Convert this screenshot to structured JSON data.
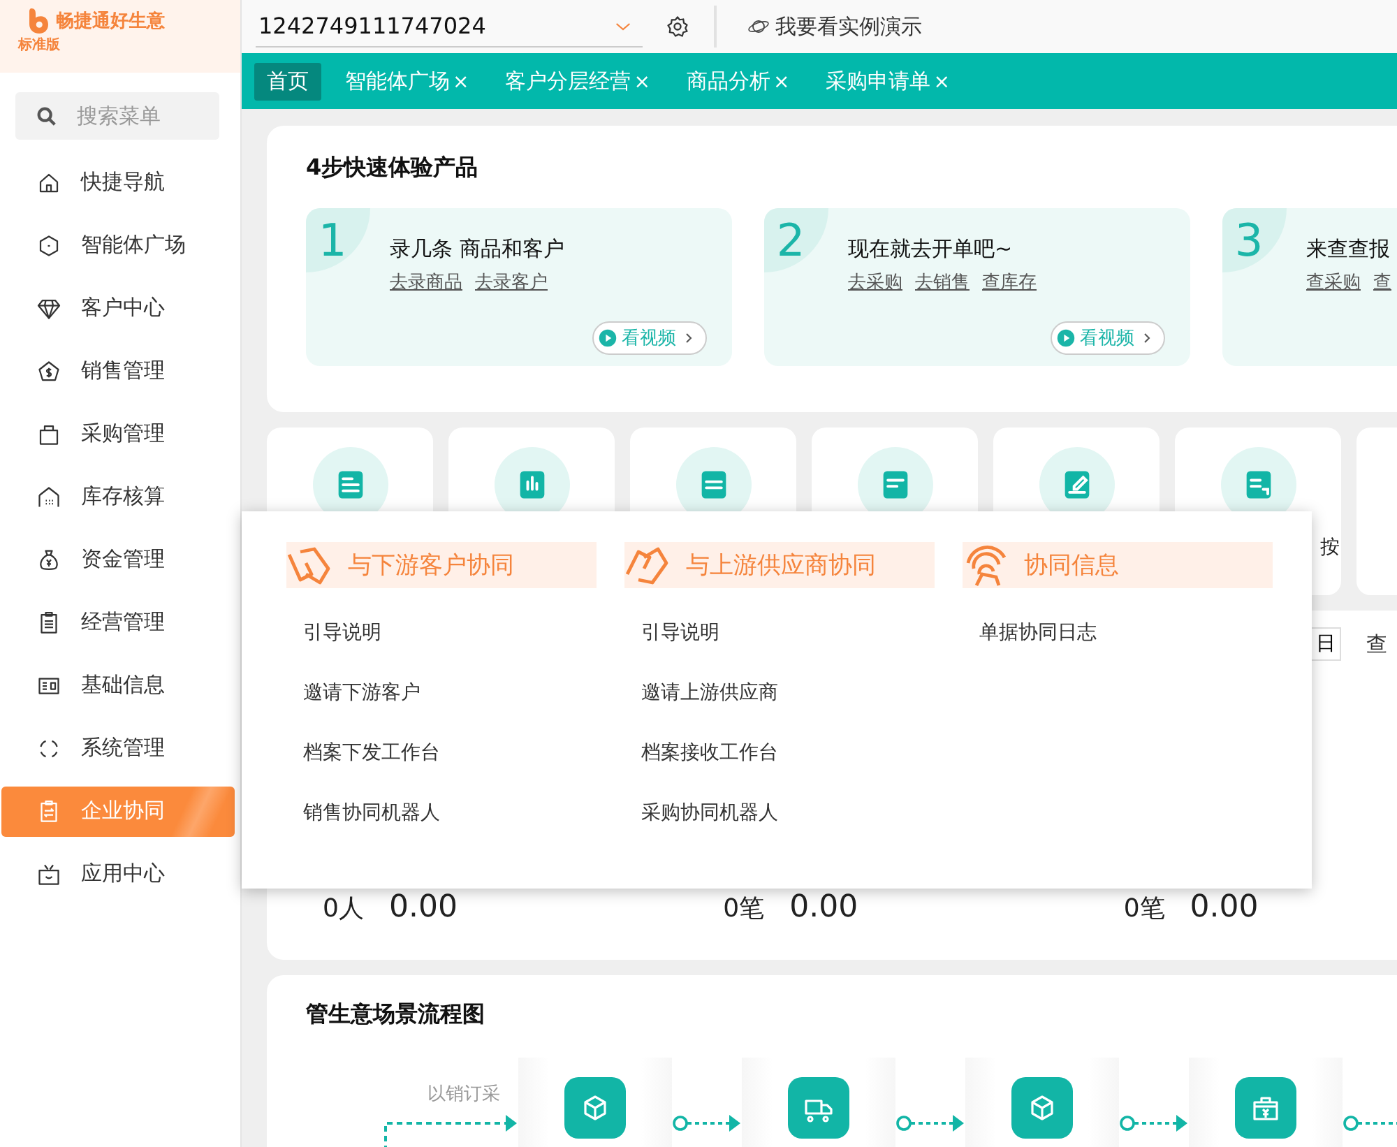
{
  "header": {
    "brand": "畅捷通好生意",
    "edition": "标准版",
    "account": "1242749111747024",
    "demo_link": "我要看实例演示"
  },
  "search": {
    "placeholder": "搜索菜单"
  },
  "sidebar": {
    "items": [
      {
        "label": "快捷导航",
        "kind": "home",
        "selected": false
      },
      {
        "label": "智能体广场",
        "kind": "ai",
        "selected": false
      },
      {
        "label": "客户中心",
        "kind": "diamond",
        "selected": false
      },
      {
        "label": "销售管理",
        "kind": "dollar-house",
        "selected": false
      },
      {
        "label": "采购管理",
        "kind": "bag",
        "selected": false
      },
      {
        "label": "库存核算",
        "kind": "warehouse",
        "selected": false
      },
      {
        "label": "资金管理",
        "kind": "money-bag",
        "selected": false
      },
      {
        "label": "经营管理",
        "kind": "clipboard",
        "selected": false
      },
      {
        "label": "基础信息",
        "kind": "id-card",
        "selected": false
      },
      {
        "label": "系统管理",
        "kind": "dots-circle",
        "selected": false
      },
      {
        "label": "企业协同",
        "kind": "clipboard-swap",
        "selected": true
      },
      {
        "label": "应用中心",
        "kind": "tv",
        "selected": false
      }
    ]
  },
  "tabs": [
    {
      "label": "首页",
      "selected": true
    },
    {
      "label": "智能体广场",
      "close": "×",
      "selected": false
    },
    {
      "label": "客户分层经营",
      "close": "×",
      "selected": false
    },
    {
      "label": "商品分析",
      "close": "×",
      "selected": false
    },
    {
      "label": "采购申请单",
      "close": "×",
      "selected": false
    }
  ],
  "quick_start": {
    "title": "4步快速体验产品",
    "steps": [
      {
        "number": "1",
        "title": "录几条 商品和客户",
        "links": [
          "去录商品",
          "去录客户"
        ],
        "video": "看视频"
      },
      {
        "number": "2",
        "title": "现在就去开单吧~",
        "links": [
          "去采购",
          "去销售",
          "查库存"
        ],
        "video": "看视频"
      },
      {
        "number": "3",
        "title": "来查查报",
        "links": [
          "查采购",
          "查"
        ]
      }
    ]
  },
  "shortcuts": [
    {
      "kind": "profile"
    },
    {
      "kind": "bar-chart"
    },
    {
      "kind": "ticket"
    },
    {
      "kind": "document"
    },
    {
      "kind": "edit"
    },
    {
      "kind": "receipt",
      "label": "按"
    },
    {
      "kind": "offscreen"
    }
  ],
  "summary": {
    "date_field": "日",
    "query": "查",
    "stats": [
      {
        "count": "0人",
        "amount": "0.00"
      },
      {
        "count": "0笔",
        "amount": "0.00"
      },
      {
        "count": "0笔",
        "amount": "0.00"
      }
    ]
  },
  "dropdown": {
    "columns": [
      {
        "title": "与下游客户协同",
        "kind": "downstream",
        "items": [
          "引导说明",
          "邀请下游客户",
          "档案下发工作台",
          "销售协同机器人"
        ]
      },
      {
        "title": "与上游供应商协同",
        "kind": "upstream",
        "items": [
          "引导说明",
          "邀请上游供应商",
          "档案接收工作台",
          "采购协同机器人"
        ]
      },
      {
        "title": "协同信息",
        "kind": "info",
        "items": [
          "单据协同日志"
        ]
      }
    ]
  },
  "flow": {
    "title": "管生意场景流程图",
    "branch_label": "以销订采",
    "nodes": [
      {
        "kind": "box"
      },
      {
        "kind": "truck"
      },
      {
        "kind": "box"
      },
      {
        "kind": "cash-box"
      }
    ]
  }
}
